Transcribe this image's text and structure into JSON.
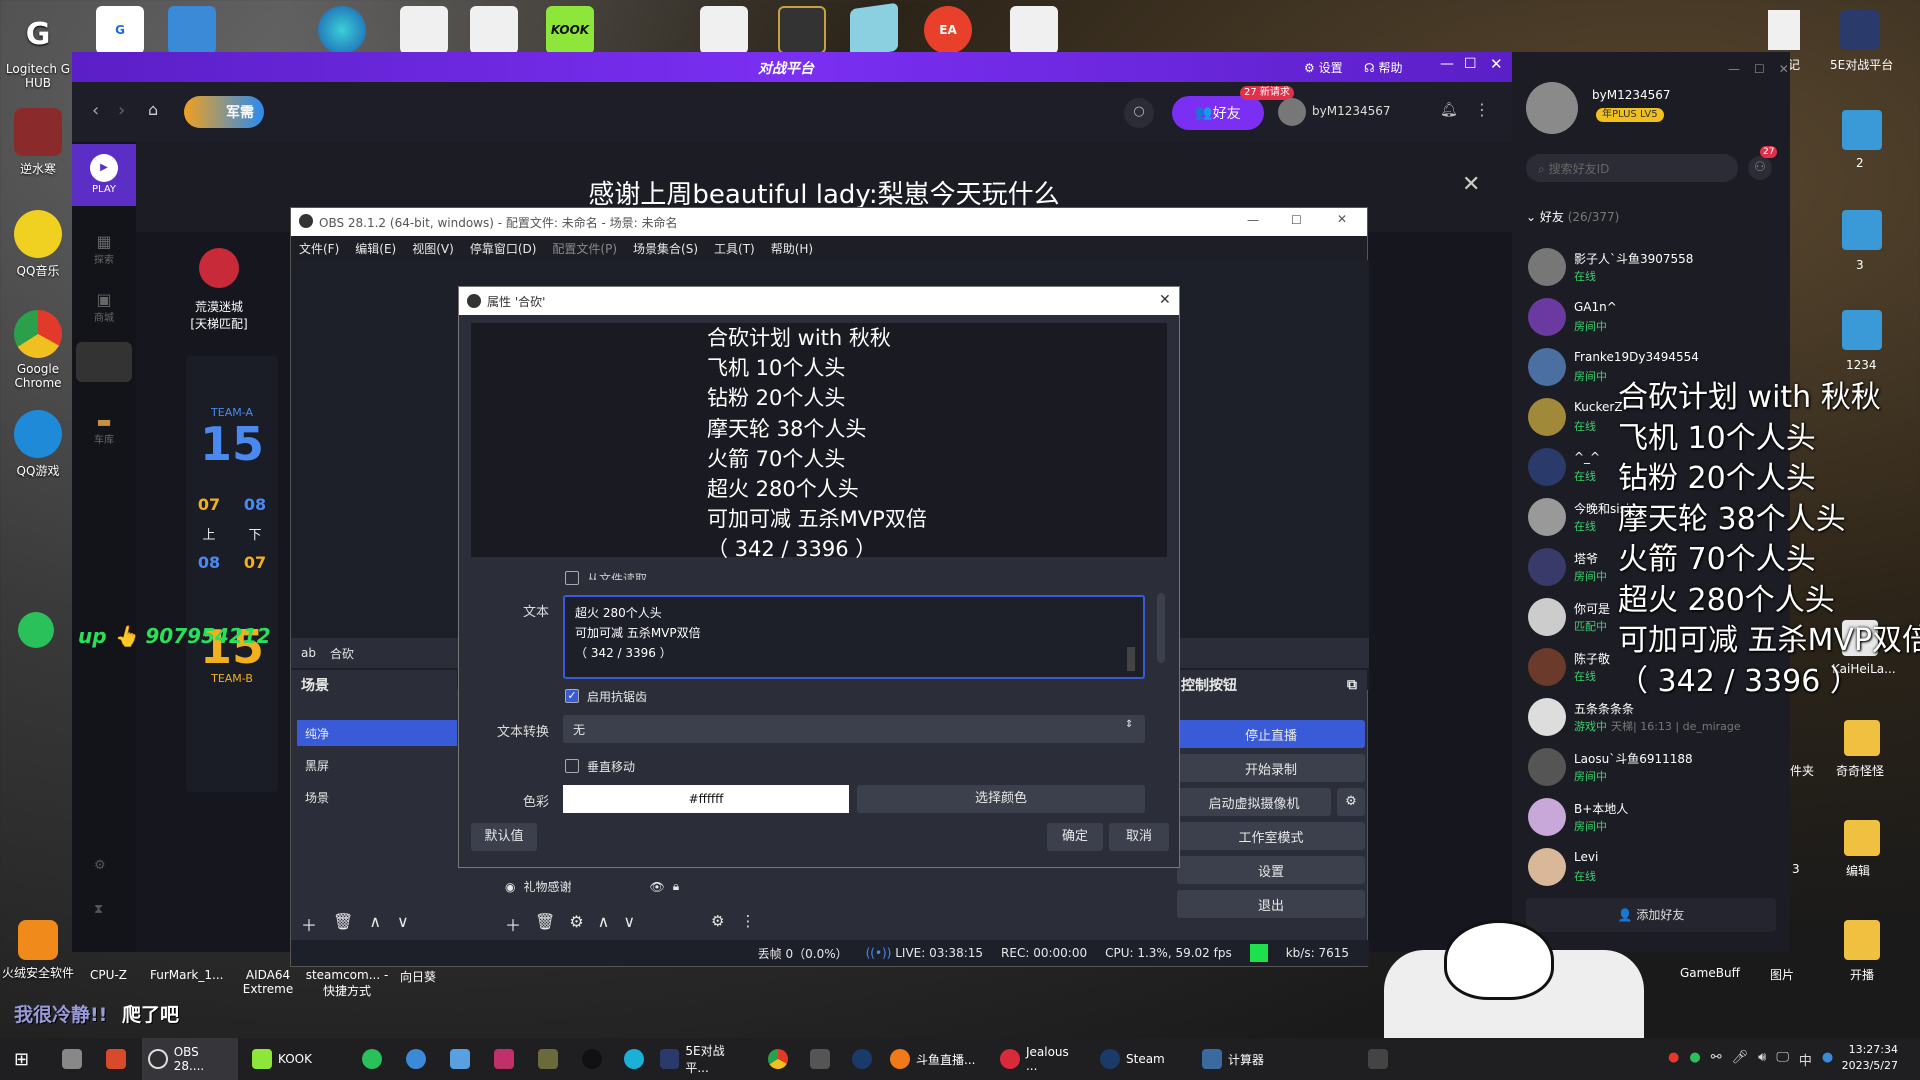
{
  "desktop": {
    "left_icons": [
      {
        "label": "Logitech G HUB",
        "icon": "logitech-icon",
        "color": "#222"
      },
      {
        "label": "逆水寒",
        "icon": "game-icon",
        "color": "#8a2a2a"
      },
      {
        "label": "QQ音乐",
        "icon": "music-icon",
        "color": "#1ec95d"
      },
      {
        "label": "Google Chrome",
        "icon": "chrome-icon",
        "color": "#e0e0e0"
      },
      {
        "label": "QQ游戏",
        "icon": "qqgame-icon",
        "color": "#1f8ad8"
      }
    ],
    "bottom_icons": [
      "火绒安全软件",
      "CPU-Z",
      "FurMark_1...",
      "AIDA64 Extreme",
      "steamcom... - 快捷方式",
      "向日葵"
    ],
    "right_icons": [
      "日记",
      "5E对战平台",
      "2",
      "3",
      "1234",
      "KaiHeiLa...",
      "件夹",
      "奇奇怪怪",
      "3",
      "编辑",
      "图",
      "GameBuff",
      "图片",
      "开播"
    ]
  },
  "wegame": {
    "title_logo": "对战平台",
    "top_actions": {
      "settings": "设置",
      "help": "帮助"
    },
    "nav": {
      "tag": "军需",
      "friends_button": "好友",
      "friends_badge": "27 新请求",
      "username": "byM1234567"
    },
    "side": {
      "play": "PLAY",
      "items": [
        "探索",
        "商城",
        "车库"
      ]
    },
    "banner_text": "感谢上周beautiful lady:梨崽今天玩什么",
    "match": {
      "map_name": "荒漠迷城\n[天梯匹配]",
      "team_a_label": "TEAM-A",
      "team_a_score": "15",
      "team_b_label": "TEAM-B",
      "team_b_score": "15",
      "rounds_top": [
        "07",
        "08"
      ],
      "half_labels": [
        "上",
        "下"
      ],
      "rounds_bottom": [
        "08",
        "07"
      ],
      "up_text": "up",
      "qq_number": "907954212"
    }
  },
  "obs": {
    "title": "OBS 28.1.2 (64-bit, windows) - 配置文件: 未命名 - 场景: 未命名",
    "menu": [
      "文件(F)",
      "编辑(E)",
      "视图(V)",
      "停靠窗口(D)",
      "配置文件(P)",
      "场景集合(S)",
      "工具(T)",
      "帮助(H)"
    ],
    "source_row_label": "合砍",
    "scenes_header": "场景",
    "scenes": [
      "纯净",
      "黑屏",
      "场景"
    ],
    "source_item": "礼物感谢",
    "controls_header": "控制按钮",
    "controls": [
      "停止直播",
      "开始录制",
      "启动虚拟摄像机",
      "工作室模式",
      "设置",
      "退出"
    ],
    "status": {
      "dropped": "丢帧 0（0.0%）",
      "live": "LIVE: 03:38:15",
      "rec": "REC: 00:00:00",
      "cpu": "CPU: 1.3%, 59.02 fps",
      "kbs": "kb/s: 7615"
    }
  },
  "dialog": {
    "title": "属性 '合砍'",
    "preview_lines": [
      "合砍计划 with 秋秋",
      "飞机 10个人头",
      "钻粉 20个人头",
      "摩天轮 38个人头",
      "火箭 70个人头",
      "超火 280个人头",
      "可加可减 五杀MVP双倍",
      "（ 342 / 3396 ）"
    ],
    "read_from_file": "从文件读取",
    "text_label": "文本",
    "text_value_lines": [
      "超火 280个人头",
      "可加可减 五杀MVP双倍",
      "（ 342 / 3396 ）"
    ],
    "antialias_label": "启用抗锯齿",
    "antialias_checked": true,
    "transform_label": "文本转换",
    "transform_value": "无",
    "vertical_label": "垂直移动",
    "color_label": "色彩",
    "color_value": "#ffffff",
    "choose_color": "选择颜色",
    "defaults": "默认值",
    "ok": "确定",
    "cancel": "取消"
  },
  "friends": {
    "username": "byM1234567",
    "vip": "年PLUS LV5",
    "search_placeholder": "搜索好友ID",
    "badge": "27",
    "group_label": "好友",
    "group_count": "(26/377)",
    "list": [
      {
        "name": "影子人`斗鱼3907558",
        "status": "在线",
        "color": "#3ad06b",
        "av": "#777"
      },
      {
        "name": "GA1n^",
        "status": "房间中",
        "color": "#3ad06b",
        "av": "#6a3aa0"
      },
      {
        "name": "Franke19Dy3494554",
        "status": "房间中",
        "color": "#3ad06b",
        "av": "#4a6fa0"
      },
      {
        "name": "KuckerZ",
        "status": "在线",
        "color": "#3ad06b",
        "av": "#a08a3a"
      },
      {
        "name": "^_^",
        "status": "在线",
        "color": "#3ad06b",
        "av": "#2a3a6a"
      },
      {
        "name": "今晚和sisi",
        "status": "在线",
        "color": "#3ad06b",
        "av": "#999"
      },
      {
        "name": "塔爷",
        "status": "房间中",
        "color": "#3ad06b",
        "av": "#3a3a6a"
      },
      {
        "name": "你可是",
        "status": "匹配中",
        "color": "#3ad06b",
        "av": "#ccc"
      },
      {
        "name": "陈子敬",
        "status": "在线",
        "color": "#3ad06b",
        "av": "#6a3a2a"
      },
      {
        "name": "五条条条条",
        "status": "游戏中",
        "extra": "天梯| 16:13 | de_mirage",
        "color": "#3ad06b",
        "av": "#ddd"
      },
      {
        "name": "Laosu`斗鱼6911188",
        "status": "房间中",
        "color": "#3ad06b",
        "av": "#555"
      },
      {
        "name": "B+本地人",
        "status": "房间中",
        "color": "#3ad06b",
        "av": "#c8a8d8"
      },
      {
        "name": "Levi",
        "status": "在线",
        "color": "#3ad06b",
        "av": "#d8b898"
      }
    ],
    "add_friend": "添加好友"
  },
  "overlay_lines": [
    "合砍计划 with 秋秋",
    "飞机 10个人头",
    "钻粉 20个人头",
    "摩天轮 38个人头",
    "火箭 70个人头",
    "超火 280个人头",
    "可加可减 五杀MVP双倍",
    "（ 342 / 3396 ）"
  ],
  "stream_caption": {
    "left": "我很冷静!!",
    "right": "爬了吧"
  },
  "taskbar": {
    "apps": [
      {
        "label": "OBS 28....",
        "color": "#302e31"
      },
      {
        "label": "KOOK",
        "color": "#8ee63a"
      },
      {
        "label": "5E对战平...",
        "color": "#2a3a6a"
      },
      {
        "label": "斗鱼直播...",
        "color": "#f07a1a"
      },
      {
        "label": "Jealous ...",
        "color": "#d82a3a"
      },
      {
        "label": "Steam",
        "color": "#1a3a6a"
      },
      {
        "label": "计算器",
        "color": "#3a6aa0"
      }
    ],
    "time": "13:27:34",
    "date": "2023/5/27",
    "ime": "中"
  }
}
